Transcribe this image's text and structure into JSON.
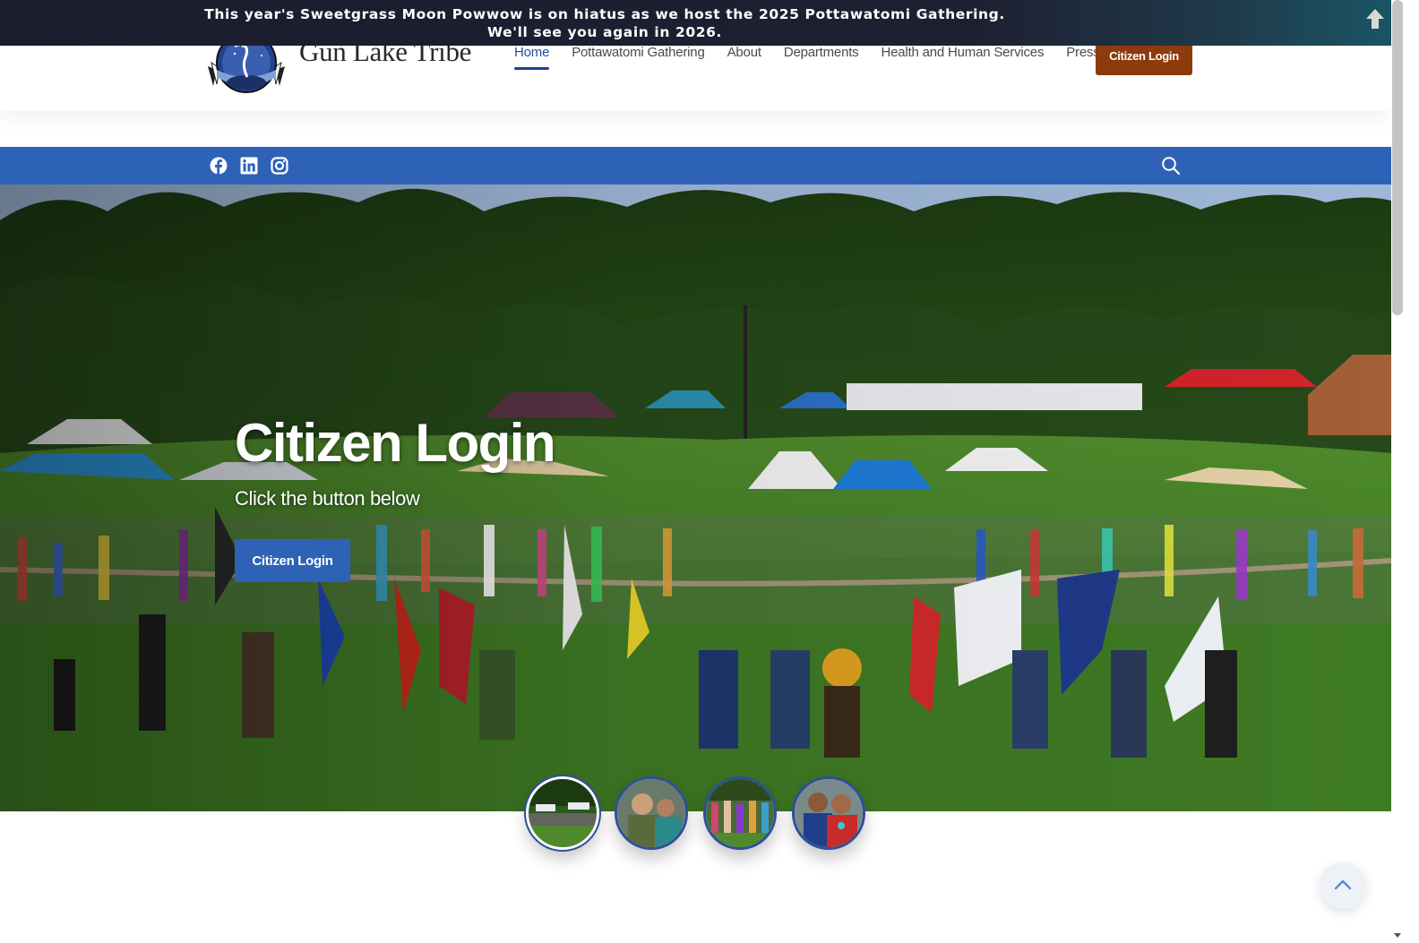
{
  "announcement": {
    "line1": "This year's Sweetgrass Moon Powwow is on hiatus as we host the 2025 Pottawatomi Gathering.",
    "line2": "We'll see you again in 2026.",
    "toggle_icon": "arrow-up-icon"
  },
  "header": {
    "site_title": "Gun Lake Tribe",
    "logo_icon": "tribal-seal-logo",
    "nav": [
      {
        "label": "Home",
        "active": true
      },
      {
        "label": "Pottawatomi Gathering",
        "active": false
      },
      {
        "label": "About",
        "active": false
      },
      {
        "label": "Departments",
        "active": false
      },
      {
        "label": "Health and Human Services",
        "active": false
      },
      {
        "label": "Press",
        "active": false
      }
    ],
    "cta_label": "Citizen Login"
  },
  "social": {
    "icons": [
      "facebook-icon",
      "linkedin-icon",
      "instagram-icon"
    ],
    "search_icon": "search-icon"
  },
  "hero": {
    "title": "Citizen Login",
    "subtitle": "Click the button below",
    "button_label": "Citizen Login"
  },
  "slider": {
    "count": 4,
    "active_index": 0
  },
  "colors": {
    "primary_blue": "#2d62b6",
    "cta_brown": "#8d3a0c",
    "announcement_bg": "#1e2032",
    "nav_text": "#4a4a4a"
  }
}
